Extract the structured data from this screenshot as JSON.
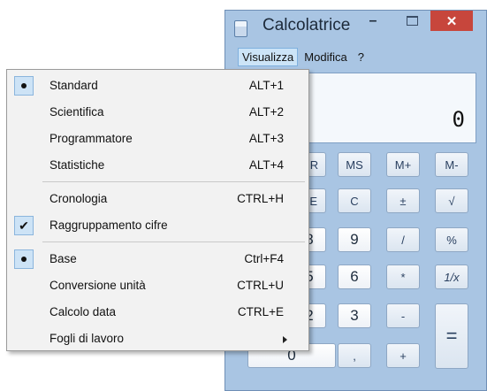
{
  "window": {
    "title": "Calcolatrice",
    "icon": "calculator-icon",
    "controls": {
      "minimize": "–",
      "close": "✕"
    }
  },
  "menubar": [
    {
      "label": "Visualizza",
      "active": true
    },
    {
      "label": "Modifica",
      "active": false
    },
    {
      "label": "?",
      "active": false
    }
  ],
  "display": {
    "value": "0"
  },
  "keypad": {
    "memory": [
      "MR",
      "MS",
      "M+",
      "M-"
    ],
    "row2": [
      "CE",
      "C",
      "±",
      "√"
    ],
    "row3": [
      "8",
      "9",
      "/",
      "%"
    ],
    "row4": [
      "5",
      "6",
      "*",
      "1/x"
    ],
    "row5": [
      "2",
      "3",
      "-"
    ],
    "row6": [
      "0",
      ",",
      "+"
    ],
    "equals": "=",
    "partial_visible": [
      "MR",
      "CE",
      "8",
      "5",
      "2"
    ]
  },
  "dropdown": {
    "items": [
      {
        "label": "Standard",
        "shortcut": "ALT+1",
        "mark": "radio"
      },
      {
        "label": "Scientifica",
        "shortcut": "ALT+2",
        "mark": "none"
      },
      {
        "label": "Programmatore",
        "shortcut": "ALT+3",
        "mark": "none"
      },
      {
        "label": "Statistiche",
        "shortcut": "ALT+4",
        "mark": "none"
      },
      {
        "label": "Cronologia",
        "shortcut": "CTRL+H",
        "mark": "none"
      },
      {
        "label": "Raggruppamento cifre",
        "shortcut": "",
        "mark": "check"
      },
      {
        "label": "Base",
        "shortcut": "Ctrl+F4",
        "mark": "radio"
      },
      {
        "label": "Conversione unità",
        "shortcut": "CTRL+U",
        "mark": "none"
      },
      {
        "label": "Calcolo data",
        "shortcut": "CTRL+E",
        "mark": "none"
      },
      {
        "label": "Fogli di lavoro",
        "shortcut": "",
        "mark": "submenu"
      }
    ]
  },
  "colors": {
    "window_bg": "#a9c5e3",
    "close_button": "#c7463c",
    "menu_highlight": "#cde3f6"
  }
}
